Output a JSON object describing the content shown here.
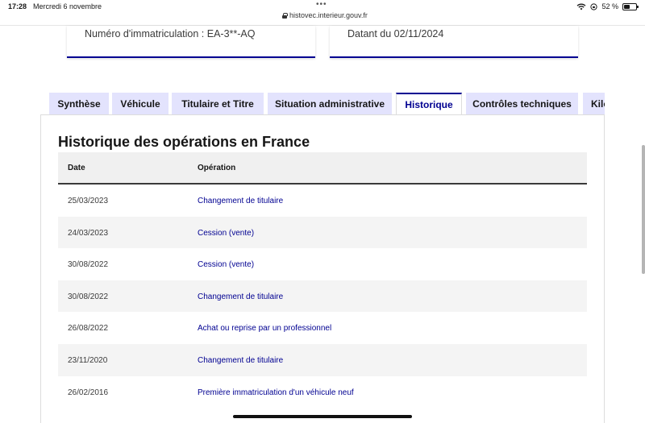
{
  "status_bar": {
    "time": "17:28",
    "date": "Mercredi 6 novembre",
    "url": "histovec.interieur.gouv.fr",
    "battery": "52 %",
    "battery_fraction": 0.52
  },
  "cards": {
    "registration": "Numéro d'immatriculation : EA-3**-AQ",
    "dated": "Datant du 02/11/2024"
  },
  "tabs": [
    {
      "label": "Synthèse"
    },
    {
      "label": "Véhicule"
    },
    {
      "label": "Titulaire et Titre"
    },
    {
      "label": "Situation administrative"
    },
    {
      "label": "Historique",
      "active": true
    },
    {
      "label": "Contrôles techniques"
    },
    {
      "label": "Kilo"
    }
  ],
  "history": {
    "title": "Historique des opérations en France",
    "columns": {
      "date": "Date",
      "operation": "Opération"
    },
    "rows": [
      {
        "date": "25/03/2023",
        "operation": "Changement de titulaire"
      },
      {
        "date": "24/03/2023",
        "operation": "Cession (vente)"
      },
      {
        "date": "30/08/2022",
        "operation": "Cession (vente)"
      },
      {
        "date": "30/08/2022",
        "operation": "Changement de titulaire"
      },
      {
        "date": "26/08/2022",
        "operation": "Achat ou reprise par un professionnel"
      },
      {
        "date": "23/11/2020",
        "operation": "Changement de titulaire"
      },
      {
        "date": "26/02/2016",
        "operation": "Première immatriculation d'un véhicule neuf"
      }
    ]
  },
  "colors": {
    "accent": "#000091",
    "tab_bg": "#e3e3fd",
    "row_alt": "#f4f4f4"
  }
}
